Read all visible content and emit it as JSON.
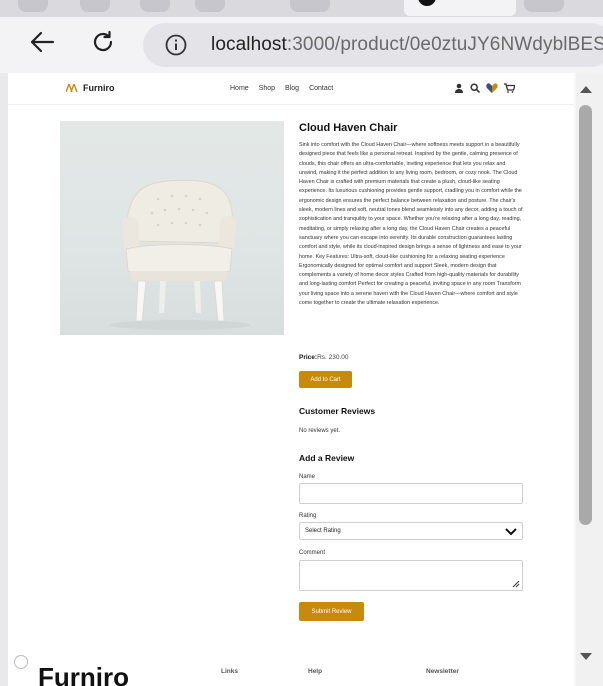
{
  "browser": {
    "url_host": "localhost",
    "url_path": ":3000/product/0e0ztuJY6NWdyblBES"
  },
  "header": {
    "brand": "Furniro",
    "nav": [
      "Home",
      "Shop",
      "Blog",
      "Contact"
    ],
    "icons": [
      "user-icon",
      "search-icon",
      "heart-icon",
      "cart-icon"
    ]
  },
  "product": {
    "title": "Cloud Haven Chair",
    "description": "Sink into comfort with the Cloud Haven Chair—where softness meets support in a beautifully designed piece that feels like a personal retreat. Inspired by the gentle, calming presence of clouds, this chair offers an ultra-comfortable, inviting experience that lets you relax and unwind, making it the perfect addition to any living room, bedroom, or cozy nook. The Cloud Haven Chair is crafted with premium materials that create a plush, cloud-like seating experience. Its luxurious cushioning provides gentle support, cradling you in comfort while the ergonomic design ensures the perfect balance between relaxation and posture. The chair's sleek, modern lines and soft, neutral tones blend seamlessly into any decor, adding a touch of sophistication and tranquility to your space. Whether you're relaxing after a long day, reading, meditating, or simply relaxing after a long day, the Cloud Haven Chair creates a peaceful sanctuary where you can escape into serenity. Its durable construction guarantees lasting comfort and style, while its cloud-inspired design brings a sense of lightness and ease to your home. Key Features: Ultra-soft, cloud-like cushioning for a relaxing seating experience Ergonomically designed for optimal comfort and support Sleek, modern design that complements a variety of home decor styles Crafted from high-quality materials for durability and long-lasting comfort Perfect for creating a peaceful, inviting space in any room Transform your living space into a serene haven with the Cloud Haven Chair—where comfort and style come together to create the ultimate relaxation experience.",
    "price_label": "Price:",
    "price_value": "Rs. 230.00",
    "add_to_cart": "Add to Cart"
  },
  "reviews": {
    "heading": "Customer Reviews",
    "empty_text": "No reviews yet.",
    "form_heading": "Add a Review",
    "name_label": "Name",
    "rating_label": "Rating",
    "rating_selected": "Select Rating",
    "comment_label": "Comment",
    "submit": "Submit Review"
  },
  "footer": {
    "brand": "Furniro",
    "columns": [
      "Links",
      "Help",
      "Newsletter"
    ]
  },
  "colors": {
    "accent": "#c78a0b"
  }
}
